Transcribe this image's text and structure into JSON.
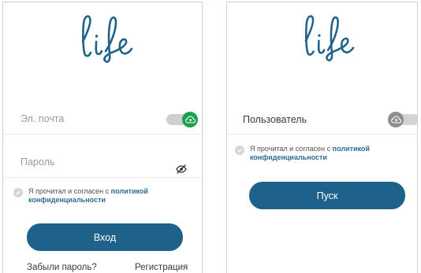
{
  "colors": {
    "brand_blue": "#1e6289",
    "link_blue": "#2a6e94",
    "toggle_on": "#1aa34a",
    "toggle_off": "#8e8e8e"
  },
  "login_screen": {
    "logo_icon": "life-logo",
    "email_label": "Эл. почта",
    "cloud_toggle": {
      "icon": "cloud-sync-icon",
      "state": "on"
    },
    "password_label": "Пароль",
    "password_visibility_icon": "eye-off-icon",
    "agree": {
      "text": "Я прочитал и согласен с ",
      "link": "политикой конфиденциальности"
    },
    "login_button": "Вход",
    "forgot_password": "Забыли пароль?",
    "register": "Регистрация"
  },
  "user_screen": {
    "logo_icon": "life-logo",
    "user_label": "Пользователь",
    "cloud_toggle": {
      "icon": "cloud-sync-icon",
      "state": "off"
    },
    "agree": {
      "text": "Я прочитал и согласен с ",
      "link": "политикой конфиденциальности"
    },
    "start_button": "Пуск"
  }
}
